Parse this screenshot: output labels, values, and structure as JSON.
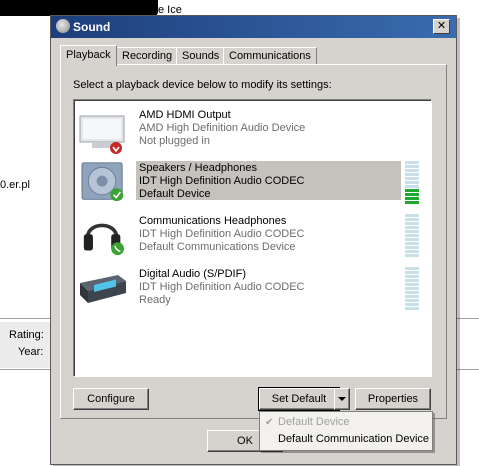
{
  "background": {
    "text_ice": "e Ice",
    "text_url": "0.er.pl",
    "label_rating": "Rating:",
    "label_year": "Year:"
  },
  "dialog": {
    "title": "Sound",
    "close_glyph": "✕",
    "tabs": [
      {
        "label": "Playback",
        "active": true
      },
      {
        "label": "Recording",
        "active": false
      },
      {
        "label": "Sounds",
        "active": false
      },
      {
        "label": "Communications",
        "active": false
      }
    ],
    "instruction": "Select a playback device below to modify its settings:",
    "devices": [
      {
        "name": "AMD HDMI Output",
        "driver": "AMD High Definition Audio Device",
        "status": "Not plugged in",
        "icon": "monitor-icon",
        "selected": false,
        "level": null
      },
      {
        "name": "Speakers / Headphones",
        "driver": "IDT High Definition Audio CODEC",
        "status": "Default Device",
        "icon": "speaker-icon",
        "selected": true,
        "level": 0.35
      },
      {
        "name": "Communications Headphones",
        "driver": "IDT High Definition Audio CODEC",
        "status": "Default Communications Device",
        "icon": "headphones-icon",
        "selected": false,
        "level": 0
      },
      {
        "name": "Digital Audio (S/PDIF)",
        "driver": "IDT High Definition Audio CODEC",
        "status": "Ready",
        "icon": "spdif-device-icon",
        "selected": false,
        "level": 0
      }
    ],
    "buttons": {
      "configure": "Configure",
      "set_default": "Set Default",
      "properties": "Properties",
      "ok": "OK"
    },
    "set_default_menu": [
      {
        "label": "Default Device",
        "enabled": false,
        "checked": true
      },
      {
        "label": "Default Communication Device",
        "enabled": true,
        "checked": false
      }
    ]
  },
  "colors": {
    "dialog_face": "#d6d3ce",
    "title_bar": "#1d3e7a",
    "selection": "#c5c2bd",
    "meter_on": "#1fa82e",
    "meter_off": "#c8e0e8",
    "default_check": "#3aa335"
  }
}
